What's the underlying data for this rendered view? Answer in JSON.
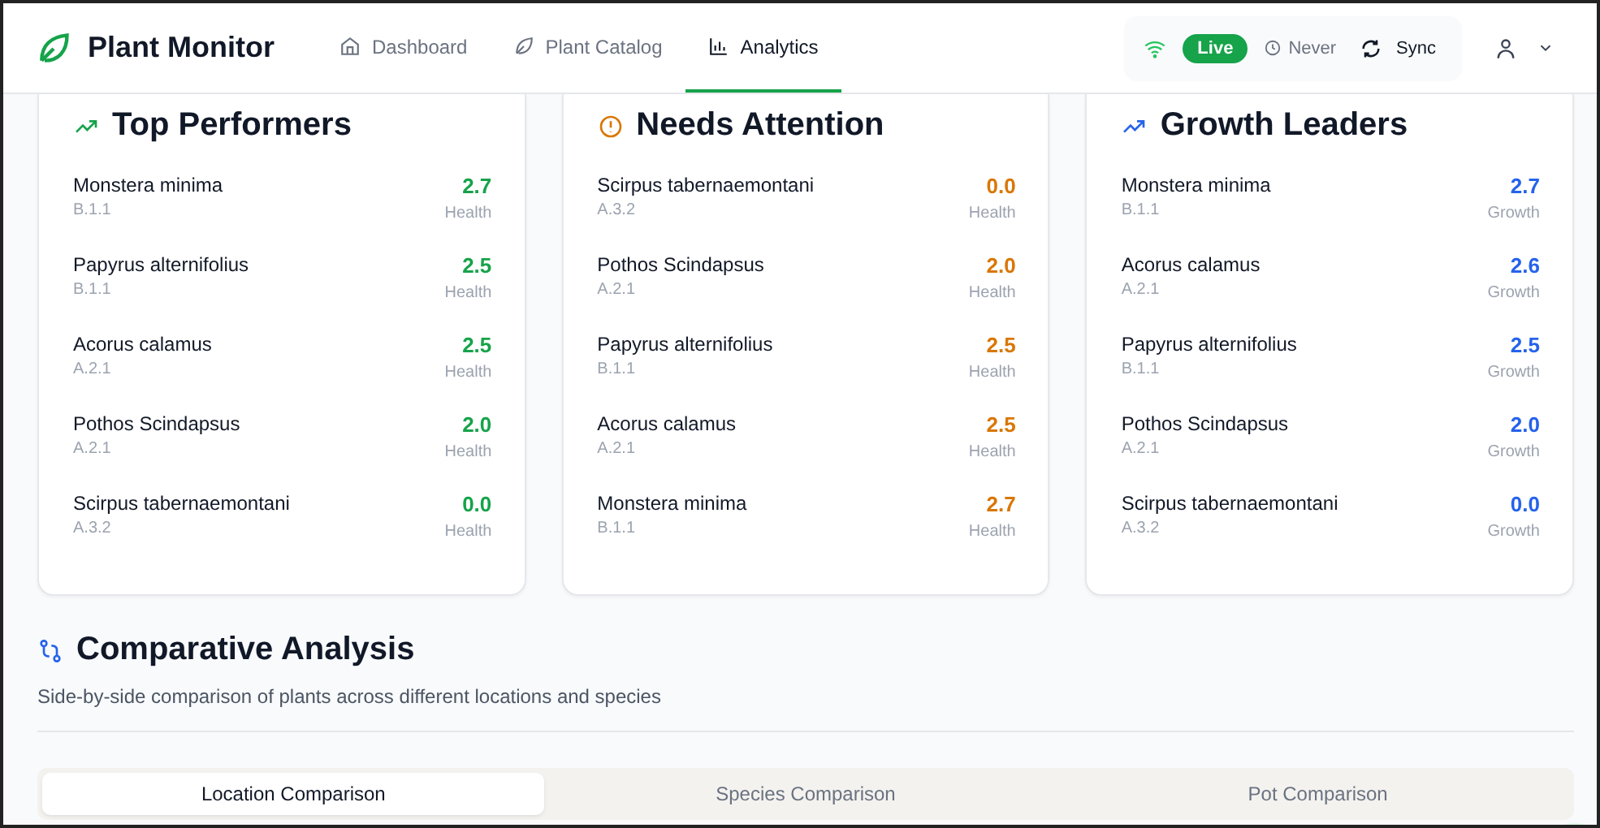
{
  "header": {
    "brand": "Plant Monitor",
    "nav": [
      {
        "label": "Dashboard",
        "selected": false
      },
      {
        "label": "Plant Catalog",
        "selected": false
      },
      {
        "label": "Analytics",
        "selected": true
      }
    ],
    "status": {
      "connected": true,
      "badge": "Live",
      "last_sync": "Never",
      "sync_button": "Sync"
    }
  },
  "cards": [
    {
      "title": "Top Performers",
      "kind": "top",
      "rows": [
        {
          "name": "Monstera minima",
          "location": "B.1.1",
          "value": "2.7",
          "metric": "Health"
        },
        {
          "name": "Papyrus alternifolius",
          "location": "B.1.1",
          "value": "2.5",
          "metric": "Health"
        },
        {
          "name": "Acorus calamus",
          "location": "A.2.1",
          "value": "2.5",
          "metric": "Health"
        },
        {
          "name": "Pothos Scindapsus",
          "location": "A.2.1",
          "value": "2.0",
          "metric": "Health"
        },
        {
          "name": "Scirpus tabernaemontani",
          "location": "A.3.2",
          "value": "0.0",
          "metric": "Health"
        }
      ]
    },
    {
      "title": "Needs Attention",
      "kind": "attention",
      "rows": [
        {
          "name": "Scirpus tabernaemontani",
          "location": "A.3.2",
          "value": "0.0",
          "metric": "Health"
        },
        {
          "name": "Pothos Scindapsus",
          "location": "A.2.1",
          "value": "2.0",
          "metric": "Health"
        },
        {
          "name": "Papyrus alternifolius",
          "location": "B.1.1",
          "value": "2.5",
          "metric": "Health"
        },
        {
          "name": "Acorus calamus",
          "location": "A.2.1",
          "value": "2.5",
          "metric": "Health"
        },
        {
          "name": "Monstera minima",
          "location": "B.1.1",
          "value": "2.7",
          "metric": "Health"
        }
      ]
    },
    {
      "title": "Growth Leaders",
      "kind": "growth",
      "rows": [
        {
          "name": "Monstera minima",
          "location": "B.1.1",
          "value": "2.7",
          "metric": "Growth"
        },
        {
          "name": "Acorus calamus",
          "location": "A.2.1",
          "value": "2.6",
          "metric": "Growth"
        },
        {
          "name": "Papyrus alternifolius",
          "location": "B.1.1",
          "value": "2.5",
          "metric": "Growth"
        },
        {
          "name": "Pothos Scindapsus",
          "location": "A.2.1",
          "value": "2.0",
          "metric": "Growth"
        },
        {
          "name": "Scirpus tabernaemontani",
          "location": "A.3.2",
          "value": "0.0",
          "metric": "Growth"
        }
      ]
    }
  ],
  "comparison": {
    "title": "Comparative Analysis",
    "subtitle": "Side-by-side comparison of plants across different locations and species",
    "tabs": [
      {
        "label": "Location Comparison",
        "selected": true
      },
      {
        "label": "Species Comparison",
        "selected": false
      },
      {
        "label": "Pot Comparison",
        "selected": false
      }
    ]
  }
}
